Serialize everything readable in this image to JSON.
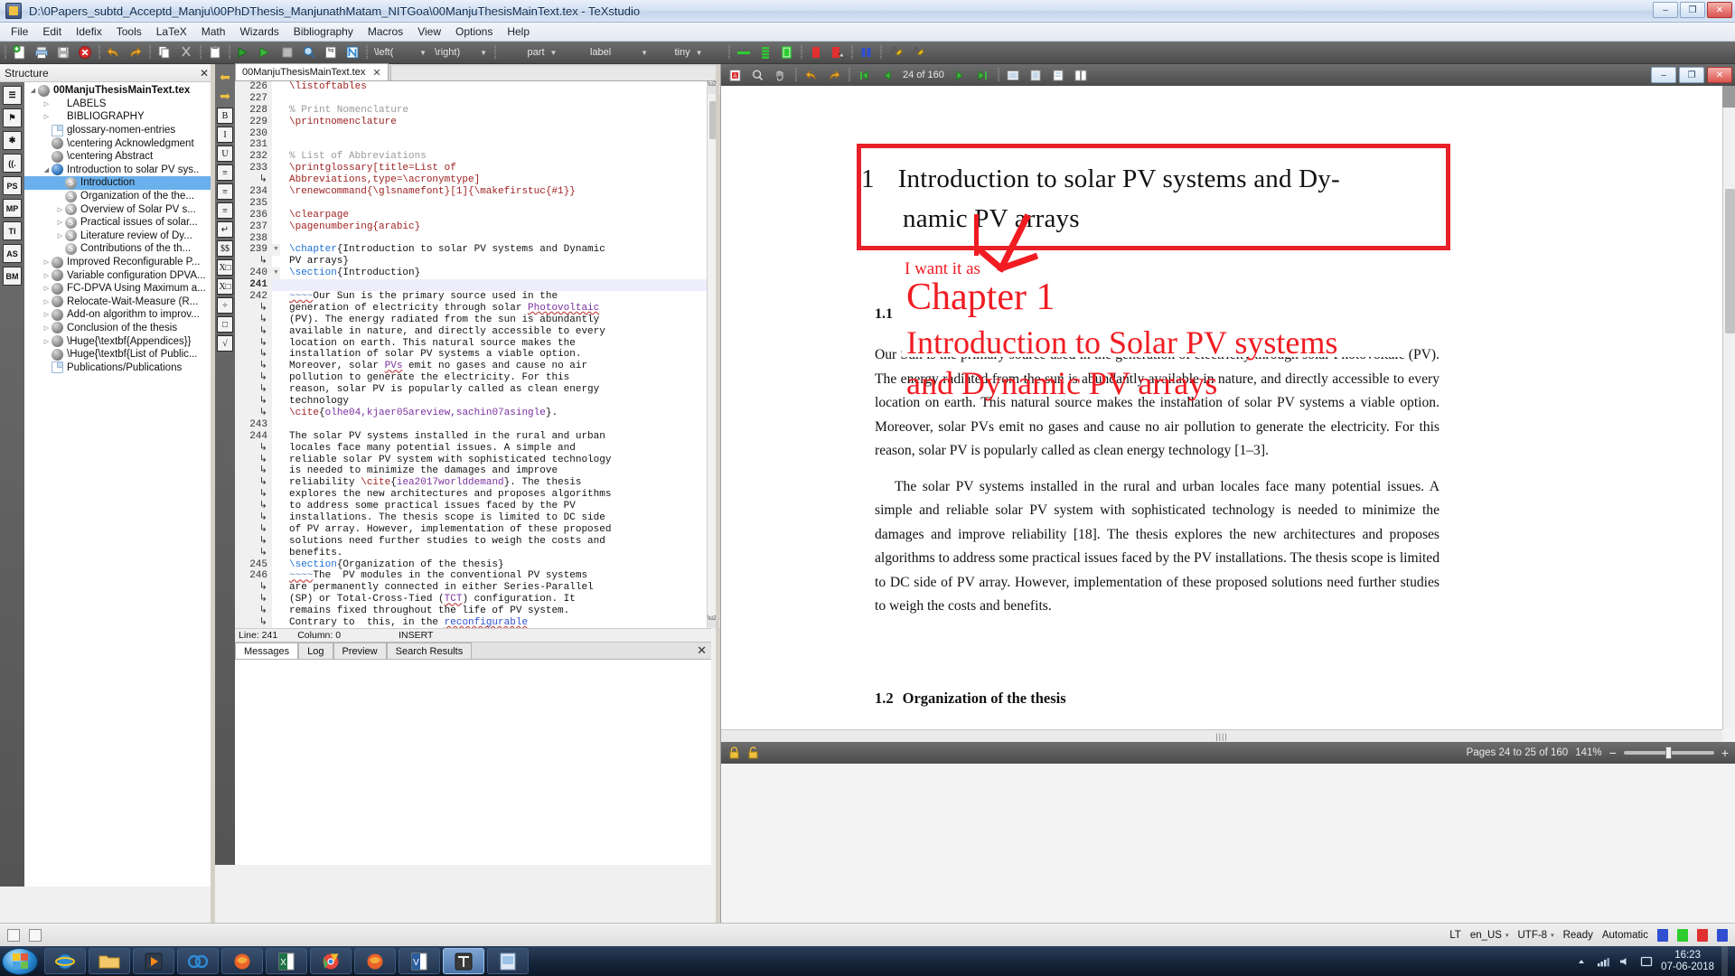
{
  "window": {
    "title": "D:\\0Papers_subtd_Acceptd_Manju\\00PhDThesis_ManjunathMatam_NITGoa\\00ManjuThesisMainText.tex - TeXstudio",
    "minimize": "–",
    "maximize": "❐",
    "close": "✕"
  },
  "menu": {
    "items": [
      "File",
      "Edit",
      "Idefix",
      "Tools",
      "LaTeX",
      "Math",
      "Wizards",
      "Bibliography",
      "Macros",
      "View",
      "Options",
      "Help"
    ]
  },
  "toolbar": {
    "combos": [
      {
        "name": "left-delimiter",
        "value": "\\left("
      },
      {
        "name": "right-delimiter",
        "value": "\\right)"
      },
      {
        "name": "section-level",
        "value": "part"
      },
      {
        "name": "label-style",
        "value": "label"
      },
      {
        "name": "font-size",
        "value": "tiny"
      }
    ],
    "buttons": [
      "new-document",
      "print",
      "save",
      "close-document",
      "undo",
      "redo",
      "copy",
      "cut",
      "paste",
      "build-and-view",
      "compile",
      "stop",
      "view-log",
      "log",
      "nomenclature",
      "green-marker",
      "view-pdf",
      "clear-markers",
      "error-marker",
      "bookmark-blue",
      "highlight-yellow",
      "highlight-yellow-2"
    ]
  },
  "structure": {
    "title": "Structure",
    "close": "✕",
    "vertical_tabs": [
      "☰",
      "⚑",
      "✱",
      "((.",
      "PS",
      "MP",
      "TI",
      "AS",
      "BM"
    ],
    "items": [
      {
        "label": "00ManjuThesisMainText.tex",
        "indent": 0,
        "icon": "arrow-down",
        "type": "root",
        "arrow": "◢"
      },
      {
        "label": "LABELS",
        "indent": 1,
        "icon": "none",
        "type": "group",
        "arrow": "▷"
      },
      {
        "label": "BIBLIOGRAPHY",
        "indent": 1,
        "icon": "none",
        "type": "group",
        "arrow": "▷"
      },
      {
        "label": "glossary-nomen-entries",
        "indent": 1,
        "icon": "file",
        "type": "file",
        "arrow": ""
      },
      {
        "label": "\\centering Acknowledgment",
        "indent": 1,
        "icon": "chapter-gray",
        "type": "chapter",
        "arrow": ""
      },
      {
        "label": "\\centering Abstract",
        "indent": 1,
        "icon": "chapter-gray",
        "type": "chapter",
        "arrow": ""
      },
      {
        "label": "Introduction to solar PV sys..",
        "indent": 1,
        "icon": "chapter-blue",
        "type": "chapter",
        "arrow": "◢"
      },
      {
        "label": "Introduction",
        "indent": 2,
        "icon": "section",
        "type": "section",
        "arrow": "",
        "selected": true
      },
      {
        "label": "Organization of the the...",
        "indent": 2,
        "icon": "section",
        "type": "section",
        "arrow": ""
      },
      {
        "label": "Overview of Solar PV s...",
        "indent": 2,
        "icon": "section",
        "type": "section",
        "arrow": "▷"
      },
      {
        "label": "Practical issues of solar...",
        "indent": 2,
        "icon": "section",
        "type": "section",
        "arrow": "▷"
      },
      {
        "label": "Literature review of Dy...",
        "indent": 2,
        "icon": "section",
        "type": "section",
        "arrow": "▷"
      },
      {
        "label": "Contributions of the th...",
        "indent": 2,
        "icon": "section",
        "type": "section",
        "arrow": ""
      },
      {
        "label": "Improved Reconfigurable P...",
        "indent": 1,
        "icon": "chapter-gray",
        "type": "chapter",
        "arrow": "▷"
      },
      {
        "label": "Variable configuration DPVA...",
        "indent": 1,
        "icon": "chapter-gray",
        "type": "chapter",
        "arrow": "▷"
      },
      {
        "label": "FC-DPVA Using Maximum a...",
        "indent": 1,
        "icon": "chapter-gray",
        "type": "chapter",
        "arrow": "▷"
      },
      {
        "label": "Relocate-Wait-Measure (R...",
        "indent": 1,
        "icon": "chapter-gray",
        "type": "chapter",
        "arrow": "▷"
      },
      {
        "label": "Add-on algorithm to improv...",
        "indent": 1,
        "icon": "chapter-gray",
        "type": "chapter",
        "arrow": "▷"
      },
      {
        "label": "Conclusion of the thesis",
        "indent": 1,
        "icon": "chapter-gray",
        "type": "chapter",
        "arrow": "▷"
      },
      {
        "label": "\\Huge{\\textbf{Appendices}}",
        "indent": 1,
        "icon": "chapter-gray",
        "type": "chapter",
        "arrow": "▷"
      },
      {
        "label": "\\Huge{\\textbf{List of Public...",
        "indent": 1,
        "icon": "chapter-gray",
        "type": "chapter",
        "arrow": ""
      },
      {
        "label": "Publications/Publications",
        "indent": 1,
        "icon": "file",
        "type": "file",
        "arrow": ""
      }
    ]
  },
  "editor": {
    "tab_label": "00ManjuThesisMainText.tex",
    "tab_close": "✕",
    "side_tools": [
      "⬅",
      "➡",
      "B",
      "I",
      "U",
      "≡",
      "≡",
      "≡",
      "↵",
      "$$",
      "X□",
      "X□",
      "÷",
      "□",
      "√"
    ],
    "lines": [
      {
        "num": "226",
        "text": "\\listoftables",
        "kind": "cmd",
        "change": true
      },
      {
        "num": "227",
        "text": "",
        "kind": "plain",
        "change": false
      },
      {
        "num": "228",
        "text": "% Print Nomenclature",
        "kind": "comment",
        "change": true
      },
      {
        "num": "229",
        "text": "\\printnomenclature",
        "kind": "cmd",
        "change": false
      },
      {
        "num": "230",
        "text": "",
        "kind": "plain",
        "change": true
      },
      {
        "num": "231",
        "text": "",
        "kind": "plain",
        "change": true
      },
      {
        "num": "232",
        "text": "% List of Abbreviations",
        "kind": "comment",
        "change": true
      },
      {
        "num": "233",
        "text": "\\printglossary[title=List of",
        "kind": "cmd",
        "change": false
      },
      {
        "num": "↳",
        "text": "Abbreviations,type=\\acronymtype]",
        "kind": "cmd-wrap",
        "change": false
      },
      {
        "num": "234",
        "text": "\\renewcommand{\\glsnamefont}[1]{\\makefirstuc{#1}}",
        "kind": "cmd",
        "change": false
      },
      {
        "num": "235",
        "text": "",
        "kind": "plain",
        "change": true
      },
      {
        "num": "236",
        "text": "\\clearpage",
        "kind": "cmd",
        "change": false
      },
      {
        "num": "237",
        "text": "\\pagenumbering{arabic}",
        "kind": "cmd",
        "change": false
      },
      {
        "num": "238",
        "text": "",
        "kind": "plain",
        "change": false
      },
      {
        "num": "239",
        "text": "\\chapter{Introduction to solar PV systems and Dynamic",
        "kind": "chapter",
        "change": false,
        "fold": true
      },
      {
        "num": "↳",
        "text": "PV arrays}",
        "kind": "plain-wrap",
        "change": false
      },
      {
        "num": "240",
        "text": "\\section{Introduction}",
        "kind": "section",
        "change": false,
        "fold": true
      },
      {
        "num": "241",
        "text": "",
        "kind": "plain",
        "change": true,
        "current": true
      },
      {
        "num": "242",
        "text": "~~~~Our Sun is the primary source used in the",
        "kind": "text",
        "change": false
      },
      {
        "num": "↳",
        "text": "generation of electricity through solar Photovoltaic",
        "kind": "text-misspell",
        "change": false
      },
      {
        "num": "↳",
        "text": "(PV). The energy radiated from the sun is abundantly",
        "kind": "text",
        "change": false
      },
      {
        "num": "↳",
        "text": "available in nature, and directly accessible to every",
        "kind": "text",
        "change": false
      },
      {
        "num": "↳",
        "text": "location on earth. This natural source makes the",
        "kind": "text",
        "change": false
      },
      {
        "num": "↳",
        "text": "installation of solar PV systems a viable option.",
        "kind": "text",
        "change": false
      },
      {
        "num": "↳",
        "text": "Moreover, solar PVs emit no gases and cause no air",
        "kind": "text-pvs",
        "change": false
      },
      {
        "num": "↳",
        "text": "pollution to generate the electricity. For this",
        "kind": "text",
        "change": false
      },
      {
        "num": "↳",
        "text": "reason, solar PV is popularly called as clean energy",
        "kind": "text",
        "change": false
      },
      {
        "num": "↳",
        "text": "technology",
        "kind": "text",
        "change": false
      },
      {
        "num": "↳",
        "text": "\\cite{kolhe04,kjaer05areview,sachin07asingle}.",
        "kind": "cite",
        "change": false
      },
      {
        "num": "243",
        "text": "",
        "kind": "plain",
        "change": false
      },
      {
        "num": "244",
        "text": "The solar PV systems installed in the rural and urban",
        "kind": "text",
        "change": false
      },
      {
        "num": "↳",
        "text": "locales face many potential issues. A simple and",
        "kind": "text",
        "change": false
      },
      {
        "num": "↳",
        "text": "reliable solar PV system with sophisticated technology",
        "kind": "text",
        "change": false
      },
      {
        "num": "↳",
        "text": "is needed to minimize the damages and improve",
        "kind": "text",
        "change": false
      },
      {
        "num": "↳",
        "text": "reliability \\cite{iea2017worlddemand}. The thesis",
        "kind": "cite-inline",
        "change": false
      },
      {
        "num": "↳",
        "text": "explores the new architectures and proposes algorithms",
        "kind": "text",
        "change": false
      },
      {
        "num": "↳",
        "text": "to address some practical issues faced by the PV",
        "kind": "text",
        "change": false
      },
      {
        "num": "↳",
        "text": "installations. The thesis scope is limited to DC side",
        "kind": "text",
        "change": false
      },
      {
        "num": "↳",
        "text": "of PV array. However, implementation of these proposed",
        "kind": "text",
        "change": false
      },
      {
        "num": "↳",
        "text": "solutions need further studies to weigh the costs and",
        "kind": "text",
        "change": false
      },
      {
        "num": "↳",
        "text": "benefits.",
        "kind": "text",
        "change": false
      },
      {
        "num": "245",
        "text": "\\section{Organization of the thesis}",
        "kind": "section",
        "change": false
      },
      {
        "num": "246",
        "text": "~~~~The  PV modules in the conventional PV systems",
        "kind": "text",
        "change": false
      },
      {
        "num": "↳",
        "text": "are permanently connected in either Series-Parallel",
        "kind": "text",
        "change": false
      },
      {
        "num": "↳",
        "text": "(SP) or Total-Cross-Tied (TCT) configuration. It",
        "kind": "text-tct",
        "change": false
      },
      {
        "num": "↳",
        "text": "remains fixed throughout the life of PV system.",
        "kind": "text",
        "change": false
      },
      {
        "num": "↳",
        "text": "Contrary to  this, in the reconfigurable",
        "kind": "text-reconf",
        "change": false
      }
    ],
    "status": {
      "line_label": "Line: 241",
      "column_label": "Column: 0",
      "mode": "INSERT"
    },
    "bottom_tabs": [
      {
        "label": "Messages",
        "active": true
      },
      {
        "label": "Log",
        "active": false
      },
      {
        "label": "Preview",
        "active": false
      },
      {
        "label": "Search Results",
        "active": false
      }
    ],
    "bottom_close": "✕"
  },
  "pdf": {
    "toolbar": {
      "page_indicator": "24  of 160",
      "buttons": [
        "open-external",
        "magnify",
        "print",
        "back",
        "forward",
        "previous-page",
        "next-page",
        "first-page",
        "last-page",
        "fit-width",
        "fit-page",
        "single-page",
        "continuous"
      ]
    },
    "status": {
      "pages_label": "Pages 24 to 25 of 160",
      "zoom": "141%",
      "zoom_out": "−",
      "zoom_in": "+"
    },
    "document": {
      "chapter_number": "1",
      "chapter_title_line1": "Introduction to solar PV systems and Dy-",
      "chapter_title_line2": "namic PV arrays",
      "section_number": "1.1",
      "paragraph1": "Our Sun is the primary source used in the generation of electricity through solar Photovoltaic (PV). The energy radiated from the sun is abundantly available in nature, and directly accessible to every location on earth. This natural source makes the installation of solar PV systems a viable option. Moreover, solar PVs emit no gases and cause no air pollution to generate the electricity. For this reason, solar PV is popularly called as clean energy technology [1–3].",
      "paragraph2": "The solar PV systems installed in the rural and urban locales face many potential issues. A simple and reliable solar PV system with sophisticated technology is needed to minimize the damages and improve reliability [18]. The thesis explores the new architectures and proposes algorithms to address some practical issues faced by the PV installations. The thesis scope is limited to DC side of PV array. However, implementation of these proposed solutions need further studies to weigh the costs and benefits.",
      "next_section_number": "1.2",
      "next_section_title": "Organization of the thesis",
      "visible_fragments": {
        "frag1": "y through",
        "frag2": "sola",
        "frag3": "vailable in",
        "frag4": "natu",
        "frag5": "rce makes",
        "frag6": "the",
        "frag7": "s emit no"
      }
    },
    "annotation": {
      "note": "I want it as",
      "line1": "Chapter 1",
      "line2": "Introduction to Solar PV systems",
      "line3": "and Dynamic PV arrays",
      "color": "#f01c22"
    }
  },
  "app_status": {
    "lang_code": "LT",
    "locale": "en_US",
    "encoding": "UTF-8",
    "ready": "Ready",
    "automatic": "Automatic",
    "caret": "▾"
  },
  "taskbar": {
    "start": "start",
    "apps": [
      "windows-start",
      "internet-explorer",
      "file-explorer",
      "media-player",
      "chromium-blue",
      "firefox",
      "excel",
      "chrome",
      "firefox-2",
      "visio",
      "texstudio",
      "pdf-viewer"
    ],
    "clock_time": "16:23",
    "clock_date": "07-06-2018"
  }
}
